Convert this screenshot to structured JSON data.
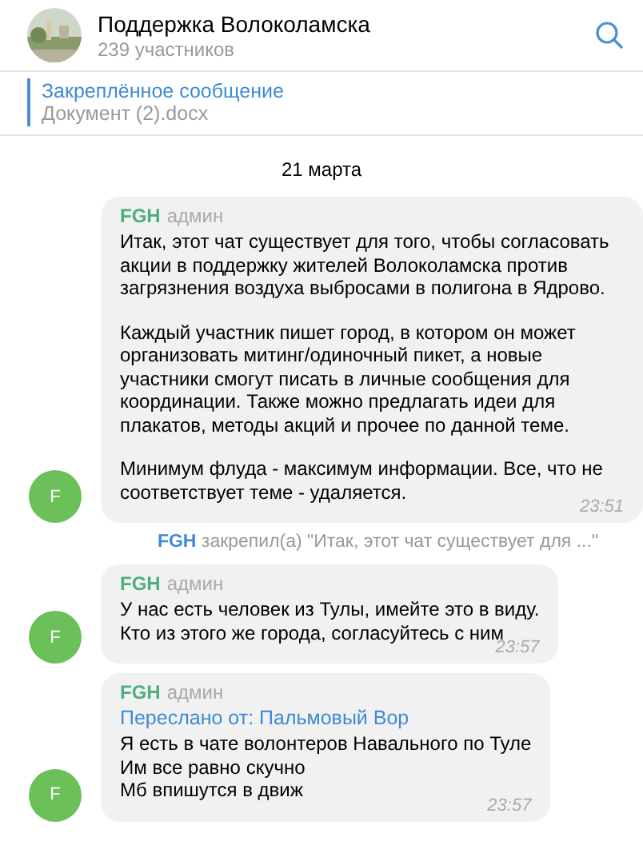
{
  "header": {
    "title": "Поддержка Волоколамска",
    "subtitle": "239 участников"
  },
  "pinned": {
    "label": "Закреплённое сообщение",
    "text": "Документ (2).docx"
  },
  "date": "21 марта",
  "messages": [
    {
      "kind": "message",
      "avatar": "F",
      "author": "FGH",
      "role": "админ",
      "paragraphs": [
        "Итак, этот чат существует для того, чтобы согласовать акции в поддержку жителей Волоколамска против загрязнения воздуха выбросами в полигона в Ядрово.",
        "Каждый участник пишет город, в котором он может организовать митинг/одиночный пикет, а новые участники смогут писать в личные сообщения для координации. Также можно предлагать идеи для плакатов, методы акций и прочее по данной теме.",
        "Минимум флуда - максимум информации. Все, что не соответствует теме - удаляется."
      ],
      "time": "23:51"
    },
    {
      "kind": "service",
      "author": "FGH",
      "text": "закрепил(а) \"Итак, этот чат существует для ...\""
    },
    {
      "kind": "message",
      "avatar": "F",
      "author": "FGH",
      "role": "админ",
      "paragraphs": [
        "У нас есть человек из Тулы, имейте это в виду.\nКто из этого же города, согласуйтесь с ним"
      ],
      "time": "23:57"
    },
    {
      "kind": "message",
      "avatar": "F",
      "author": "FGH",
      "role": "админ",
      "forwarded": "Переслано от: Пальмовый Вор",
      "paragraphs": [
        "Я есть в чате волонтеров Навального по Туле\nИм все равно скучно\nМб впишутся в движ"
      ],
      "time": "23:57"
    }
  ]
}
